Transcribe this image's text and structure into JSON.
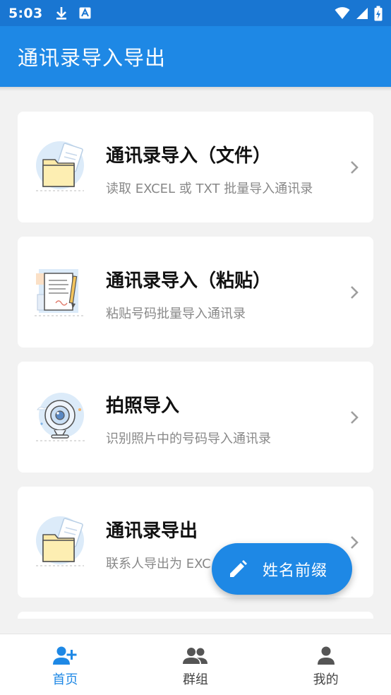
{
  "status_bar": {
    "time": "5:03",
    "left_icons": [
      "download-icon",
      "app-a-icon"
    ],
    "right_icons": [
      "wifi-icon",
      "signal-icon",
      "battery-charging-icon"
    ]
  },
  "app_bar": {
    "title": "通讯录导入导出"
  },
  "cards": [
    {
      "title": "通讯录导入（文件）",
      "subtitle": "读取 EXCEL 或 TXT 批量导入通讯录",
      "icon": "folder-icon"
    },
    {
      "title": "通讯录导入（粘贴）",
      "subtitle": "粘贴号码批量导入通讯录",
      "icon": "paste-document-icon"
    },
    {
      "title": "拍照导入",
      "subtitle": "识别照片中的号码导入通讯录",
      "icon": "camera-icon"
    },
    {
      "title": "通讯录导出",
      "subtitle": "联系人导出为 EXC",
      "icon": "folder-icon"
    }
  ],
  "fab": {
    "label": "姓名前缀",
    "icon": "pencil-icon"
  },
  "bottom_nav": [
    {
      "label": "首页",
      "icon": "person-add-icon",
      "active": true
    },
    {
      "label": "群组",
      "icon": "group-icon",
      "active": false
    },
    {
      "label": "我的",
      "icon": "person-icon",
      "active": false
    }
  ],
  "colors": {
    "primary": "#1e88e5",
    "status_bar": "#1976d2",
    "background": "#f2f2f2",
    "card": "#ffffff",
    "title_text": "#111111",
    "subtitle_text": "#888888"
  }
}
